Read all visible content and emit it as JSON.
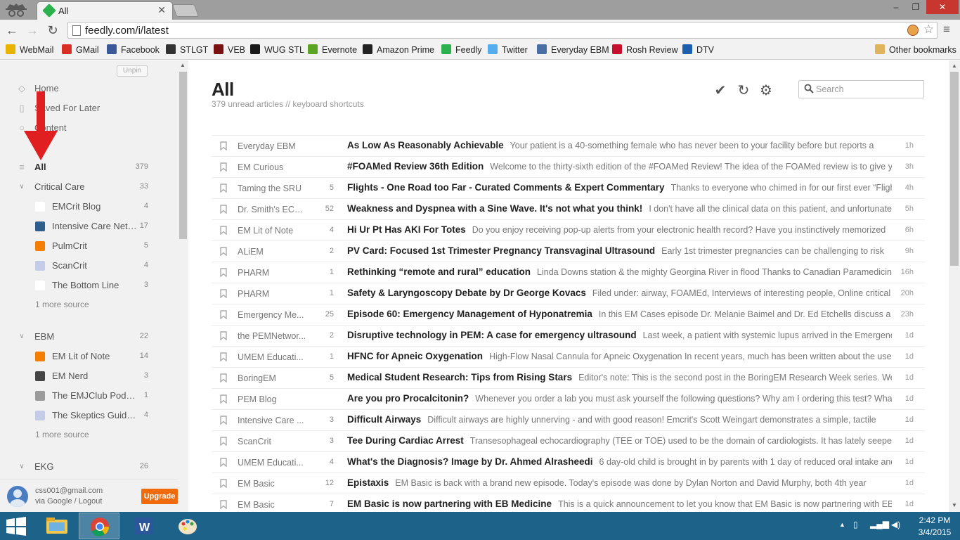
{
  "browser": {
    "tab_title": "All",
    "url": "feedly.com/i/latest",
    "window_controls": {
      "minimize": "–",
      "maximize": "❐",
      "close": "✕"
    }
  },
  "bookmarks": [
    {
      "label": "WebMail",
      "icon": "webmail-icon",
      "color": "#e8b400"
    },
    {
      "label": "GMail",
      "icon": "gmail-icon",
      "color": "#d93025"
    },
    {
      "label": "Facebook",
      "icon": "facebook-icon",
      "color": "#3b5998"
    },
    {
      "label": "STLGT",
      "icon": "stlgt-icon",
      "color": "#333333"
    },
    {
      "label": "VEB",
      "icon": "veb-icon",
      "color": "#7a1212"
    },
    {
      "label": "WUG STL",
      "icon": "wug-icon",
      "color": "#1a1a1a"
    },
    {
      "label": "Evernote",
      "icon": "evernote-icon",
      "color": "#5ba525"
    },
    {
      "label": "Amazon Prime",
      "icon": "amazon-icon",
      "color": "#222222"
    },
    {
      "label": "Feedly",
      "icon": "feedly-icon",
      "color": "#2bb24c"
    },
    {
      "label": "Twitter",
      "icon": "twitter-icon",
      "color": "#55acee"
    },
    {
      "label": "Everyday EBM",
      "icon": "everyday-ebm-icon",
      "color": "#4a6fa5"
    },
    {
      "label": "Rosh Review",
      "icon": "rosh-icon",
      "color": "#c8102e"
    },
    {
      "label": "DTV",
      "icon": "dtv-icon",
      "color": "#1b5fae"
    },
    {
      "label": "Other bookmarks",
      "icon": "folder-icon",
      "color": "#e0b45c"
    }
  ],
  "sidebar": {
    "unpin": "Unpin",
    "nav": [
      {
        "label": "Home",
        "icon": "home-icon"
      },
      {
        "label": "Saved For Later",
        "icon": "bookmark-icon"
      },
      {
        "label": "Content",
        "icon": "content-icon"
      }
    ],
    "all": {
      "label": "All",
      "count": "379"
    },
    "groups": [
      {
        "label": "Critical Care",
        "count": "33",
        "feeds": [
          {
            "label": "EMCrit Blog",
            "count": "4",
            "color": "#ffffff"
          },
          {
            "label": "Intensive Care Network",
            "count": "17",
            "color": "#2d5f8a"
          },
          {
            "label": "PulmCrit",
            "count": "5",
            "color": "#f57d00"
          },
          {
            "label": "ScanCrit",
            "count": "4",
            "color": "#c5cce8"
          },
          {
            "label": "The Bottom Line",
            "count": "3",
            "color": "#ffffff"
          }
        ],
        "more": "1 more source"
      },
      {
        "label": "EBM",
        "count": "22",
        "feeds": [
          {
            "label": "EM Lit of Note",
            "count": "14",
            "color": "#f57d00"
          },
          {
            "label": "EM Nerd",
            "count": "3",
            "color": "#444444"
          },
          {
            "label": "The EMJClub Podcast",
            "count": "1",
            "color": "#9a9a9a"
          },
          {
            "label": "The Skeptics Guide to EM",
            "count": "4",
            "color": "#c5cce8"
          }
        ],
        "more": "1 more source"
      },
      {
        "label": "EKG",
        "count": "26",
        "feeds": []
      }
    ],
    "account": {
      "email": "css001@gmail.com",
      "via": "via Google / Logout",
      "upgrade": "Upgrade"
    }
  },
  "main": {
    "title": "All",
    "subtitle": "379 unread articles  //  keyboard shortcuts",
    "search_placeholder": "Search",
    "entries": [
      {
        "source": "Everyday EBM",
        "count": "",
        "title": "As Low As Reasonably Achievable",
        "snippet": "Your patient is a 40-something female who has never been to your facility before but reports a",
        "age": "1h"
      },
      {
        "source": "EM Curious",
        "count": "",
        "title": "#FOAMed Review 36th Edition",
        "snippet": "Welcome to the thirty-sixth edition of the #FOAMed Review! The idea of the FOAMed review is to give you",
        "age": "3h"
      },
      {
        "source": "Taming the SRU",
        "count": "5",
        "title": "Flights - One Road too Far - Curated Comments & Expert Commentary",
        "snippet": "Thanks to everyone who chimed in for our first ever “Flight”!!",
        "age": "4h"
      },
      {
        "source": "Dr. Smith's ECG...",
        "count": "52",
        "title": "Weakness and Dyspnea with a Sine Wave. It's not what you think!",
        "snippet": "I don't have all the clinical data on this patient, and unfortunately",
        "age": "5h"
      },
      {
        "source": "EM Lit of Note",
        "count": "4",
        "title": "Hi Ur Pt Has AKI For Totes",
        "snippet": "Do you enjoy receiving pop-up alerts from your electronic health record?  Have you instinctively memorized",
        "age": "6h"
      },
      {
        "source": "ALiEM",
        "count": "2",
        "title": "PV Card: Focused 1st Trimester Pregnancy Transvaginal Ultrasound",
        "snippet": "Early 1st trimester pregnancies can be challenging to risk",
        "age": "9h"
      },
      {
        "source": "PHARM",
        "count": "1",
        "title": "Rethinking “remote and rural” education",
        "snippet": "Linda Downs station & the mighty Georgina River in flood Thanks to Canadian Paramedicine",
        "age": "16h"
      },
      {
        "source": "PHARM",
        "count": "1",
        "title": "Safety & Laryngoscopy Debate by Dr George Kovacs",
        "snippet": "Filed under: airway, FOAMEd, Interviews of interesting people, Online critical",
        "age": "20h"
      },
      {
        "source": "Emergency Me...",
        "count": "25",
        "title": "Episode 60: Emergency Management of Hyponatremia",
        "snippet": "In this EM Cases episode Dr. Melanie Baimel and Dr. Ed Etchells discuss a",
        "age": "23h"
      },
      {
        "source": "the PEMNetwor...",
        "count": "2",
        "title": "Disruptive technology in PEM: A case for emergency ultrasound",
        "snippet": "Last week, a patient with systemic lupus arrived in the Emergency",
        "age": "1d"
      },
      {
        "source": "UMEM Educati...",
        "count": "1",
        "title": "HFNC for Apneic Oxygenation",
        "snippet": "High-Flow Nasal Cannula for Apneic Oxygenation In recent years, much has been written about the use of",
        "age": "1d"
      },
      {
        "source": "BoringEM",
        "count": "5",
        "title": "Medical Student Research: Tips from Rising Stars",
        "snippet": "Editor's note: This is the second post in the BoringEM Research Week series. We",
        "age": "1d"
      },
      {
        "source": "PEM Blog",
        "count": "",
        "title": "Are you pro Procalcitonin?",
        "snippet": "Whenever you order a lab you must ask yourself the following questions? Why am I ordering this test? What",
        "age": "1d"
      },
      {
        "source": "Intensive Care ...",
        "count": "3",
        "title": "Difficult Airways",
        "snippet": "Difficult airways are highly unnerving - and with good reason! Emcrit's Scott Weingart demonstrates a simple, tactile",
        "age": "1d"
      },
      {
        "source": "ScanCrit",
        "count": "3",
        "title": "Tee During Cardiac Arrest",
        "snippet": "Transesophageal echocardiography (TEE or TOE) used to be the domain of cardiologists. It has lately seeped",
        "age": "1d"
      },
      {
        "source": "UMEM Educati...",
        "count": "4",
        "title": "What's the Diagnosis? Image by Dr. Ahmed Alrasheedi",
        "snippet": "6 day-old child is brought in by parents with 1 day of reduced oral intake and",
        "age": "1d"
      },
      {
        "source": "EM Basic",
        "count": "12",
        "title": "Epistaxis",
        "snippet": "EM Basic is back with a brand new episode.  Today's episode was done by Dylan Norton and David Murphy, both 4th year",
        "age": "1d"
      },
      {
        "source": "EM Basic",
        "count": "7",
        "title": "EM Basic is now partnering with EB Medicine",
        "snippet": "This is a quick announcement to let you know that EM Basic is now partnering with EB",
        "age": "1d"
      }
    ]
  },
  "taskbar": {
    "time": "2:42 PM",
    "date": "3/4/2015"
  },
  "colors": {
    "accent": "#2bb24c",
    "upgrade": "#ef6b0c",
    "taskbar": "#1c6289",
    "annotation_arrow": "#e02020"
  }
}
